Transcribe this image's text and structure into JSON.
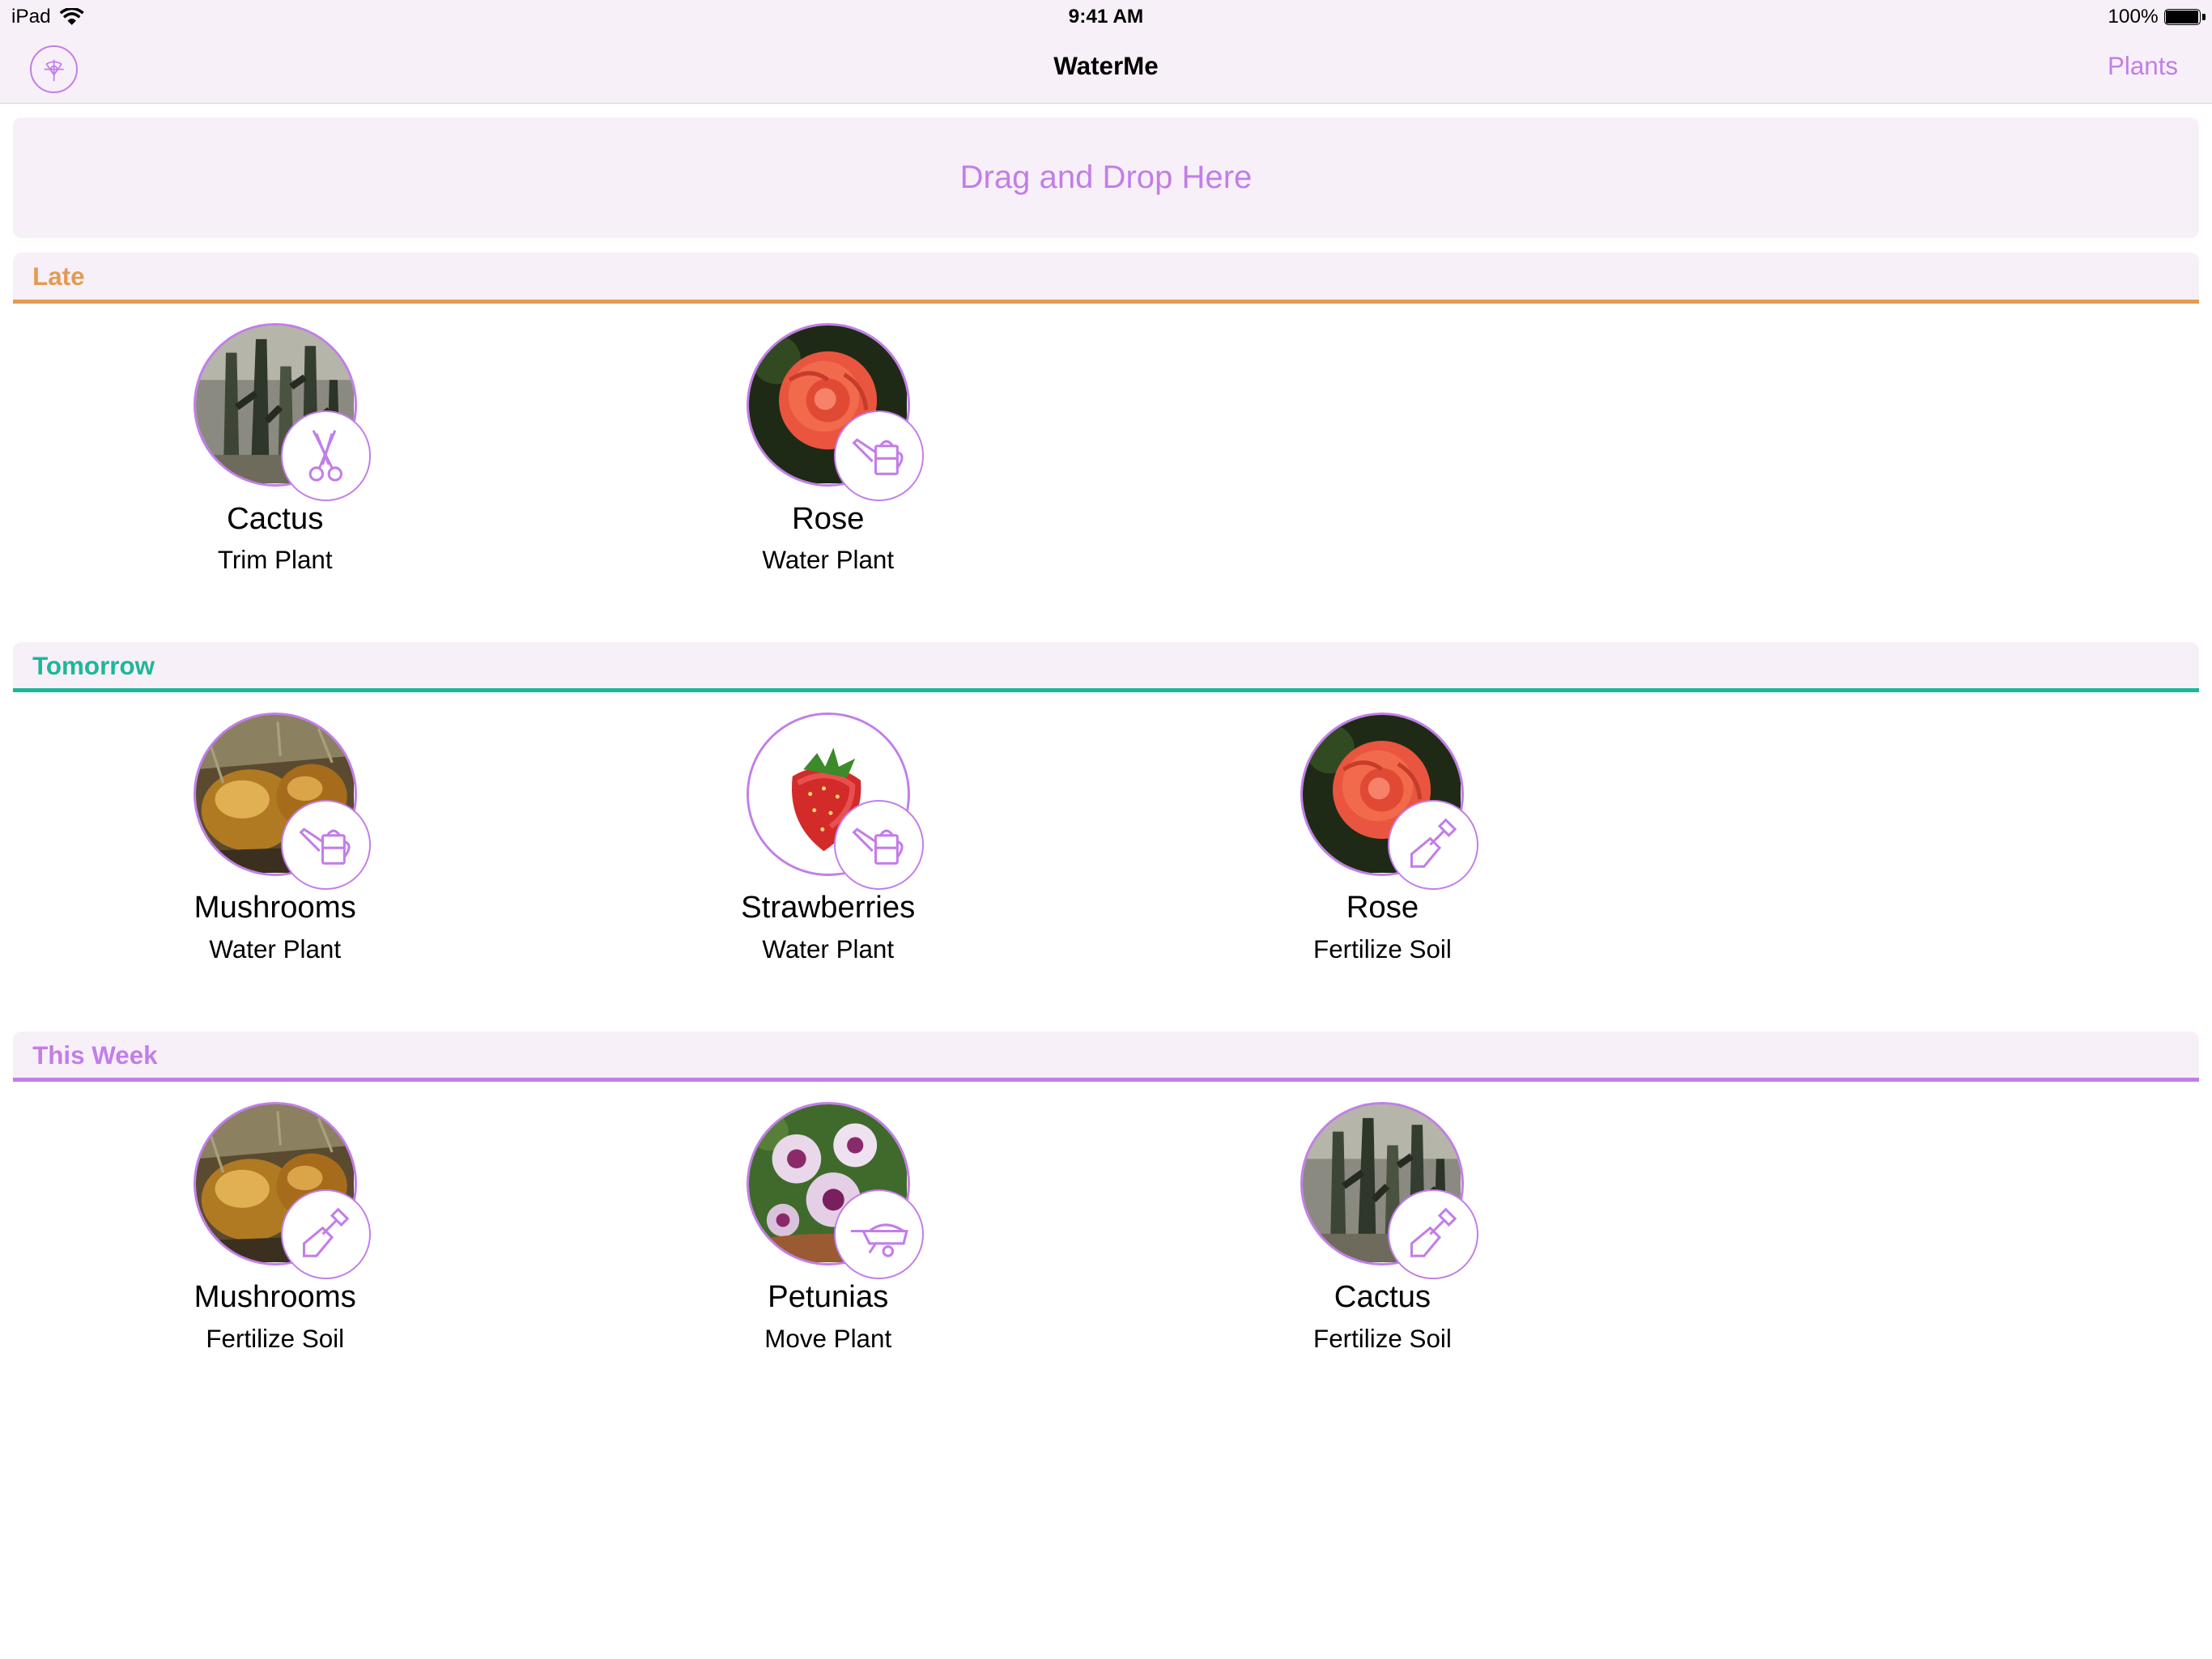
{
  "status_bar": {
    "device": "iPad",
    "time": "9:41 AM",
    "battery": "100%"
  },
  "nav": {
    "title": "WaterMe",
    "right_button": "Plants",
    "left_icon": "settings-emblem-icon"
  },
  "dropzone": {
    "label": "Drag and Drop Here"
  },
  "accent_color": "#c27ee8",
  "sections": [
    {
      "title": "Late",
      "color": "#e39b52",
      "items": [
        {
          "plant": "Cactus",
          "task": "Trim Plant",
          "photo": "cactus",
          "icon": "scissors-icon"
        },
        {
          "plant": "Rose",
          "task": "Water Plant",
          "photo": "rose",
          "icon": "watering-can-icon"
        }
      ]
    },
    {
      "title": "Tomorrow",
      "color": "#1bb89a",
      "items": [
        {
          "plant": "Mushrooms",
          "task": "Water Plant",
          "photo": "mushrooms",
          "icon": "watering-can-icon"
        },
        {
          "plant": "Strawberries",
          "task": "Water Plant",
          "photo": "strawberry",
          "icon": "watering-can-icon"
        },
        {
          "plant": "Rose",
          "task": "Fertilize Soil",
          "photo": "rose",
          "icon": "shovel-icon"
        }
      ]
    },
    {
      "title": "This Week",
      "color": "#c27ee8",
      "items": [
        {
          "plant": "Mushrooms",
          "task": "Fertilize Soil",
          "photo": "mushrooms",
          "icon": "shovel-icon"
        },
        {
          "plant": "Petunias",
          "task": "Move Plant",
          "photo": "petunias",
          "icon": "wheelbarrow-icon"
        },
        {
          "plant": "Cactus",
          "task": "Fertilize Soil",
          "photo": "cactus",
          "icon": "shovel-icon"
        }
      ]
    }
  ]
}
